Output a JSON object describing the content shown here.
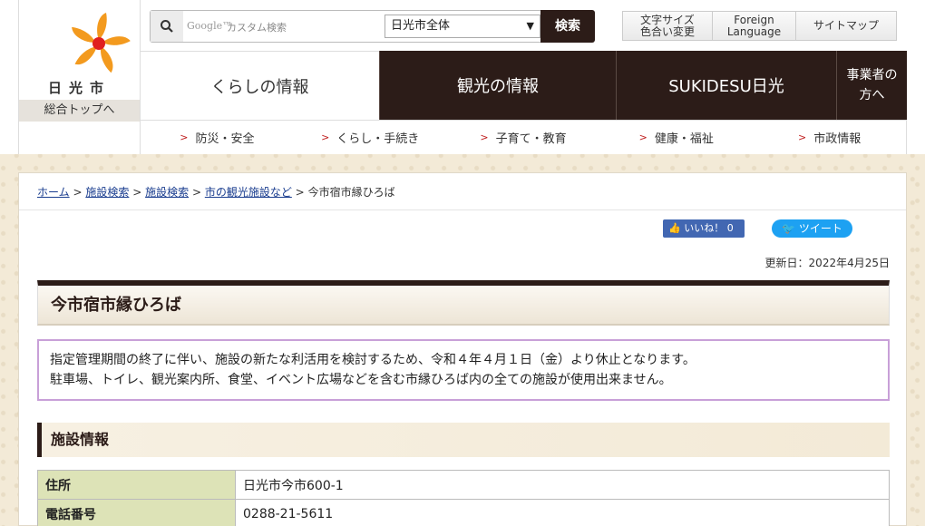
{
  "header": {
    "logo_text": "日光市",
    "top_link": "総合トップへ",
    "search": {
      "google_mark": "Google™",
      "placeholder": "カスタム検索",
      "scope_selected": "日光市全体",
      "button_label": "検索"
    },
    "util_links": [
      {
        "line1": "文字サイズ",
        "line2": "色合い変更"
      },
      {
        "line1": "Foreign",
        "line2": "Language"
      },
      {
        "line1": "サイトマップ",
        "line2": ""
      }
    ],
    "nav": [
      "くらしの情報",
      "観光の情報",
      "SUKIDESU日光",
      "事業者の方へ"
    ],
    "subnav": [
      "防災・安全",
      "くらし・手続き",
      "子育て・教育",
      "健康・福祉",
      "市政情報"
    ]
  },
  "breadcrumb": {
    "items": [
      "ホーム",
      "施設検索",
      "施設検索",
      "市の観光施設など"
    ],
    "current": "今市宿市縁ひろば",
    "separator": ">"
  },
  "social": {
    "like_label": "いいね！ 0",
    "tweet_label": "ツイート"
  },
  "updated": "更新日：2022年4月25日",
  "page_title": "今市宿市縁ひろば",
  "notice": {
    "line1": "指定管理期間の終了に伴い、施設の新たな利活用を検討するため、令和４年４月１日（金）より休止となります。",
    "line2": "駐車場、トイレ、観光案内所、食堂、イベント広場などを含む市縁ひろば内の全ての施設が使用出来ません。"
  },
  "section_heading": "施設情報",
  "facility_info": [
    {
      "label": "住所",
      "value": "日光市今市600-1"
    },
    {
      "label": "電話番号",
      "value": "0288-21-5611"
    }
  ],
  "colors": {
    "brand_dark": "#2c1c18",
    "accent_red": "#c02020",
    "notice_border": "#c8a0d8",
    "table_header": "#dde3b7",
    "logo_orange": "#f39a1e"
  }
}
